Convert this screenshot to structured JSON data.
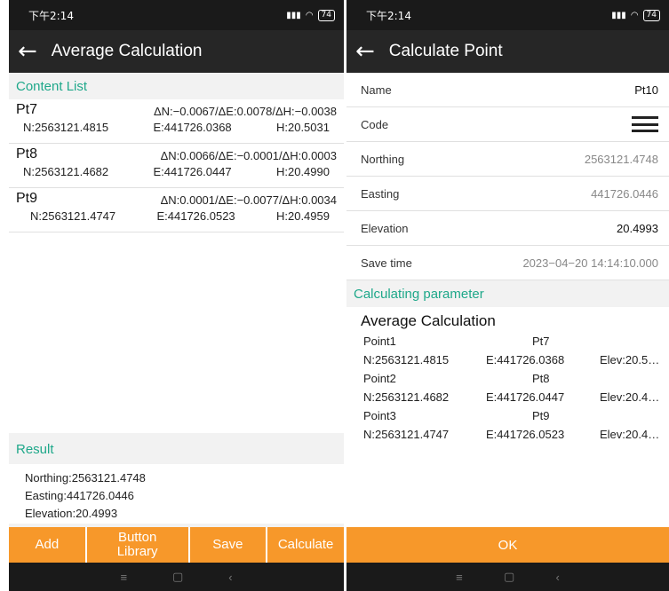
{
  "left": {
    "status": {
      "time": "下午2:14",
      "signal": "ᵗⁱˡ",
      "battery": "74"
    },
    "title": "Average Calculation",
    "content_list_title": "Content List",
    "points": [
      {
        "name": "Pt7",
        "delta": "ΔN:−0.0067/ΔE:0.0078/ΔH:−0.0038",
        "n": "N:2563121.4815",
        "e": "E:441726.0368",
        "h": "H:20.5031"
      },
      {
        "name": "Pt8",
        "delta": "ΔN:0.0066/ΔE:−0.0001/ΔH:0.0003",
        "n": "N:2563121.4682",
        "e": "E:441726.0447",
        "h": "H:20.4990"
      },
      {
        "name": "Pt9",
        "delta": "ΔN:0.0001/ΔE:−0.0077/ΔH:0.0034",
        "n": "N:2563121.4747",
        "e": "E:441726.0523",
        "h": "H:20.4959"
      }
    ],
    "result_title": "Result",
    "result": {
      "northing": "Northing:2563121.4748",
      "easting": "Easting:441726.0446",
      "elevation": "Elevation:20.4993"
    },
    "buttons": {
      "add": "Add",
      "button_library": "Button Library",
      "save": "Save",
      "calculate": "Calculate"
    }
  },
  "right": {
    "status": {
      "time": "下午2:14",
      "battery": "74"
    },
    "title": "Calculate Point",
    "fields": {
      "name_label": "Name",
      "name_value": "Pt10",
      "code_label": "Code",
      "northing_label": "Northing",
      "northing_value": "2563121.4748",
      "easting_label": "Easting",
      "easting_value": "441726.0446",
      "elevation_label": "Elevation",
      "elevation_value": "20.4993",
      "save_time_label": "Save time",
      "save_time_value": "2023−04−20 14:14:10.000"
    },
    "param_section_title": "Calculating parameter",
    "param_title": "Average Calculation",
    "params": [
      {
        "label": "Point1",
        "point": "Pt7",
        "n": "N:2563121.4815",
        "e": "E:441726.0368",
        "elev": "Elev:20.5…"
      },
      {
        "label": "Point2",
        "point": "Pt8",
        "n": "N:2563121.4682",
        "e": "E:441726.0447",
        "elev": "Elev:20.4…"
      },
      {
        "label": "Point3",
        "point": "Pt9",
        "n": "N:2563121.4747",
        "e": "E:441726.0523",
        "elev": "Elev:20.4…"
      }
    ],
    "ok_label": "OK"
  },
  "nav": {
    "menu_icon": "≡",
    "home_icon": "▢",
    "back_icon": "‹"
  },
  "colors": {
    "accent": "#f7982a",
    "section_title": "#1fa88a",
    "appbar": "#262626"
  }
}
